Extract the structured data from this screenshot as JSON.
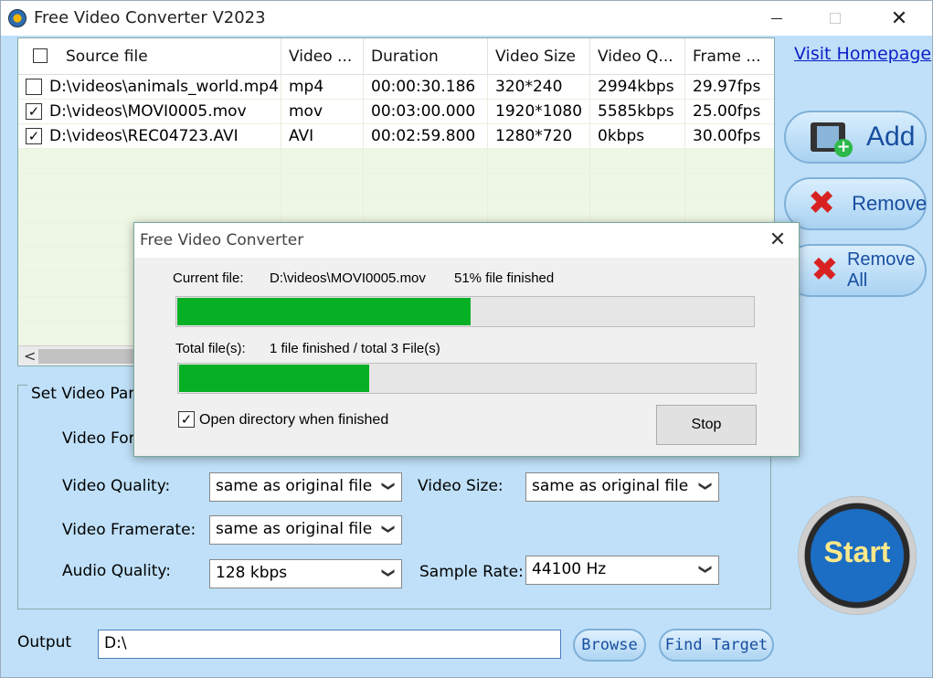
{
  "window": {
    "title": "Free Video Converter V2023",
    "close_glyph": "✕"
  },
  "table": {
    "headers": [
      "Source file",
      "Video ...",
      "Duration",
      "Video Size",
      "Video Q...",
      "Frame ..."
    ],
    "rows": [
      {
        "checked": false,
        "cells": [
          "D:\\videos\\animals_world.mp4",
          "mp4",
          "00:00:30.186",
          "320*240",
          "2994kbps",
          "29.97fps"
        ]
      },
      {
        "checked": true,
        "cells": [
          "D:\\videos\\MOVI0005.mov",
          "mov",
          "00:03:00.000",
          "1920*1080",
          "5585kbps",
          "25.00fps"
        ]
      },
      {
        "checked": true,
        "cells": [
          "D:\\videos\\REC04723.AVI",
          "AVI",
          "00:02:59.800",
          "1280*720",
          "0kbps",
          "30.00fps"
        ]
      }
    ],
    "scroll_left_glyph": "<"
  },
  "sidebar": {
    "visit_homepage": "Visit Homepage",
    "add": "Add",
    "remove": "Remove",
    "remove_all": "Remove All",
    "start": "Start"
  },
  "settings": {
    "group_title": "Set Video Par",
    "video_format_label": "Video For",
    "video_quality_label": "Video Quality:",
    "video_quality_value": "same as original file",
    "video_size_label": "Video Size:",
    "video_size_value": "same as original file",
    "video_framerate_label": "Video Framerate:",
    "video_framerate_value": "same as original file",
    "audio_quality_label": "Audio Quality:",
    "audio_quality_value": "128 kbps",
    "sample_rate_label": "Sample Rate:",
    "sample_rate_value": "44100 Hz"
  },
  "output": {
    "label": "Output",
    "value": "D:\\",
    "browse": "Browse",
    "find_target": "Find Target"
  },
  "dialog": {
    "title": "Free Video Converter",
    "current_file_label": "Current file:",
    "current_file_value": "D:\\videos\\MOVI0005.mov",
    "current_file_status": "51% file finished",
    "current_progress": 0.51,
    "total_label": "Total file(s):",
    "total_status": "1 file finished / total 3 File(s)",
    "total_progress": 0.33,
    "open_dir_label": "Open directory when finished",
    "open_dir_checked": true,
    "stop": "Stop"
  },
  "colors": {
    "progress_fill": "#06b025",
    "link": "#0b1fc8",
    "window_bg": "#bfe0f8"
  }
}
